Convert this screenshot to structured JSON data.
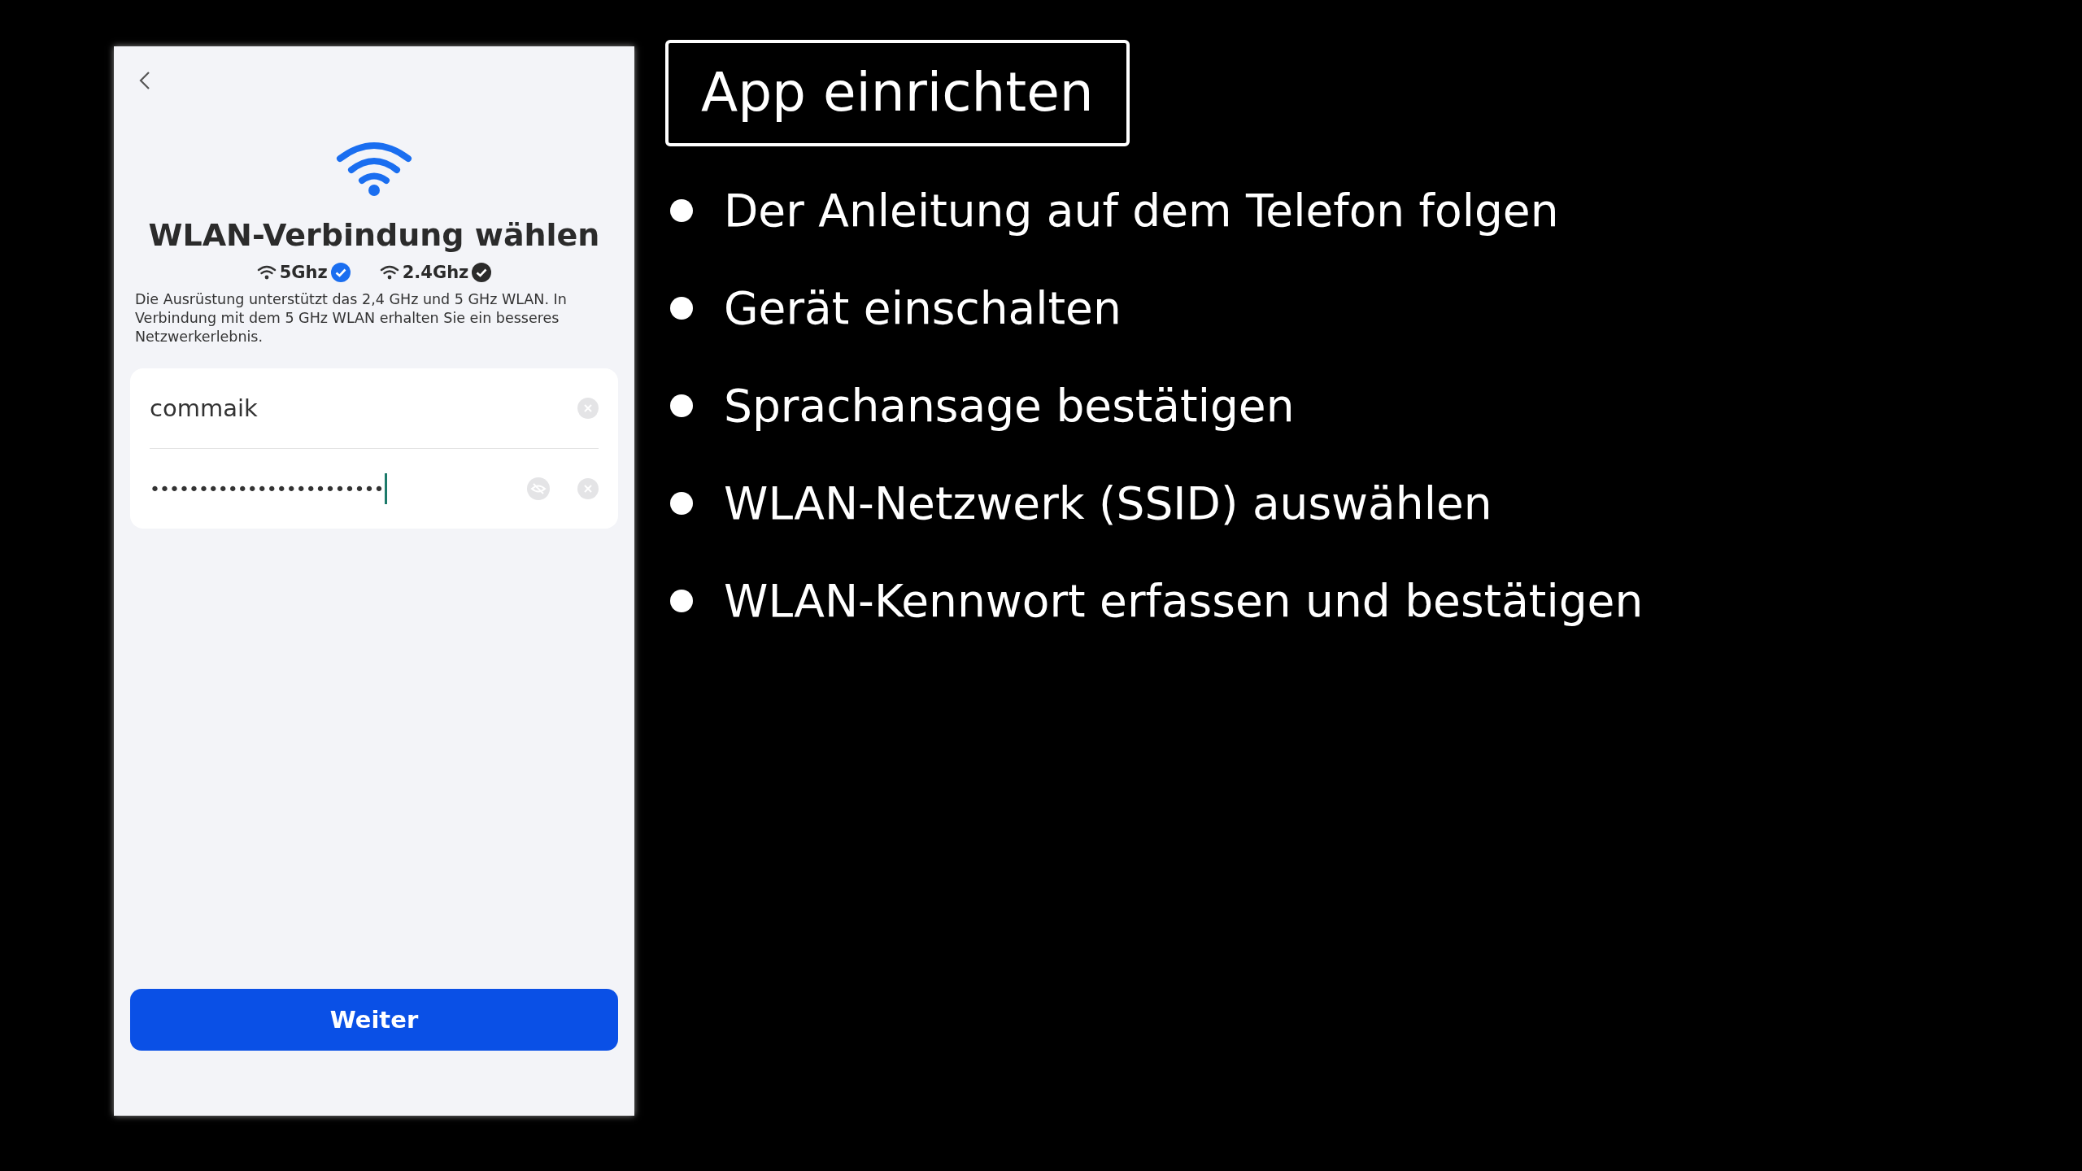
{
  "phone": {
    "title": "WLAN-Verbindung wählen",
    "bands": [
      {
        "label": "5Ghz",
        "selected": true
      },
      {
        "label": "2.4Ghz",
        "selected": false
      }
    ],
    "description": "Die Ausrüstung unterstützt das 2,4 GHz und 5 GHz WLAN. In Verbindung mit dem 5 GHz WLAN erhalten Sie ein besseres Netzwerkerlebnis.",
    "network_field": {
      "value": "commaik"
    },
    "password_field": {
      "value": "••••••••••••••••••••••••"
    },
    "button": "Weiter"
  },
  "slide": {
    "title": "App einrichten",
    "bullets": [
      "Der Anleitung auf dem Telefon folgen",
      "Gerät einschalten",
      "Sprachansage bestätigen",
      "WLAN-Netzwerk (SSID) auswählen",
      "WLAN-Kennwort erfassen und bestätigen"
    ]
  }
}
